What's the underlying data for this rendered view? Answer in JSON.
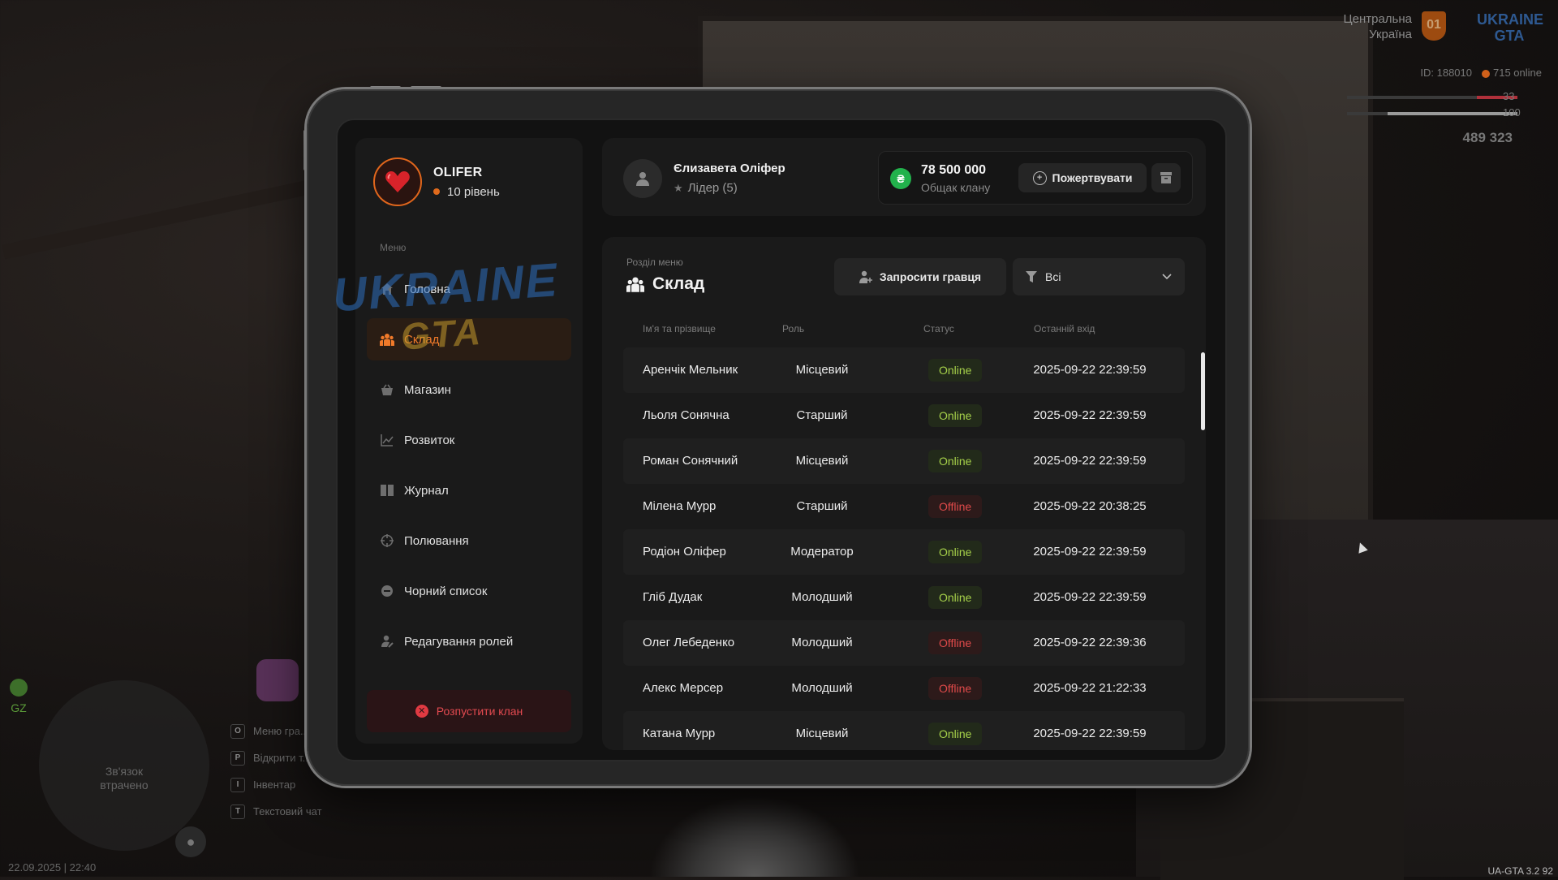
{
  "hud": {
    "region_line1": "Центральна",
    "region_line2": "Україна",
    "badge": "01",
    "logo_line1": "UKRAINE",
    "logo_line2": "GTA",
    "id_text": "ID: 188010",
    "online_text": "715 online",
    "health": "33",
    "armor": "100",
    "money": "489 323",
    "gz_label": "GZ",
    "radar_text_line1": "Зв'язок",
    "radar_text_line2": "втрачено",
    "keys": [
      {
        "key": "O",
        "label": "Меню гра..."
      },
      {
        "key": "P",
        "label": "Відкрити т..."
      },
      {
        "key": "I",
        "label": "Інвентар"
      },
      {
        "key": "T",
        "label": "Текстовий чат"
      }
    ],
    "datetime": "22.09.2025 | 22:40",
    "version": "UA-GTA 3.2",
    "fps": "92"
  },
  "profile": {
    "name": "OLIFER",
    "level": "10 рівень"
  },
  "sidebar": {
    "menu_caption": "Меню",
    "items": [
      {
        "label": "Головна",
        "icon": "home-icon",
        "active": false
      },
      {
        "label": "Склад",
        "icon": "members-icon",
        "active": true
      },
      {
        "label": "Магазин",
        "icon": "shop-basket-icon",
        "active": false
      },
      {
        "label": "Розвиток",
        "icon": "chart-icon",
        "active": false
      },
      {
        "label": "Журнал",
        "icon": "book-icon",
        "active": false
      },
      {
        "label": "Полювання",
        "icon": "crosshair-icon",
        "active": false
      },
      {
        "label": "Чорний список",
        "icon": "minus-circle-icon",
        "active": false
      },
      {
        "label": "Редагування ролей",
        "icon": "user-edit-icon",
        "active": false
      }
    ],
    "dissolve_label": "Розпустити клан"
  },
  "header": {
    "leader_name": "Єлизавета Оліфер",
    "leader_role": "Лідер (5)",
    "bank_amount": "78 500 000",
    "bank_label": "Общак клану",
    "donate_label": "Пожертвувати",
    "coin_symbol": "₴"
  },
  "section": {
    "caption": "Розділ меню",
    "title": "Склад",
    "invite_label": "Запросити гравця",
    "filter_value": "Всі"
  },
  "table": {
    "headers": {
      "name": "Ім'я та прізвище",
      "role": "Роль",
      "status": "Статус",
      "last_login": "Останній вхід"
    },
    "rows": [
      {
        "name": "Аренчік Мельник",
        "role": "Місцевий",
        "status": "Online",
        "last_login": "2025-09-22 22:39:59"
      },
      {
        "name": "Льоля Сонячна",
        "role": "Старший",
        "status": "Online",
        "last_login": "2025-09-22 22:39:59"
      },
      {
        "name": "Роман Сонячний",
        "role": "Місцевий",
        "status": "Online",
        "last_login": "2025-09-22 22:39:59"
      },
      {
        "name": "Мілена Мурр",
        "role": "Старший",
        "status": "Offline",
        "last_login": "2025-09-22 20:38:25"
      },
      {
        "name": "Родіон Оліфер",
        "role": "Модератор",
        "status": "Online",
        "last_login": "2025-09-22 22:39:59"
      },
      {
        "name": "Гліб Дудак",
        "role": "Молодший",
        "status": "Online",
        "last_login": "2025-09-22 22:39:59"
      },
      {
        "name": "Олег Лебеденко",
        "role": "Молодший",
        "status": "Offline",
        "last_login": "2025-09-22 22:39:36"
      },
      {
        "name": "Алекс Мерсер",
        "role": "Молодший",
        "status": "Offline",
        "last_login": "2025-09-22 21:22:33"
      },
      {
        "name": "Катана Мурр",
        "role": "Місцевий",
        "status": "Online",
        "last_login": "2025-09-22 22:39:59"
      }
    ]
  },
  "watermark": {
    "line1": "UKRAINE",
    "line2": "GTA"
  },
  "colors": {
    "accent": "#f07a2a",
    "online": "#a6d14a",
    "offline": "#e04a4a",
    "danger": "#e34a50",
    "coin": "#22b24c"
  }
}
